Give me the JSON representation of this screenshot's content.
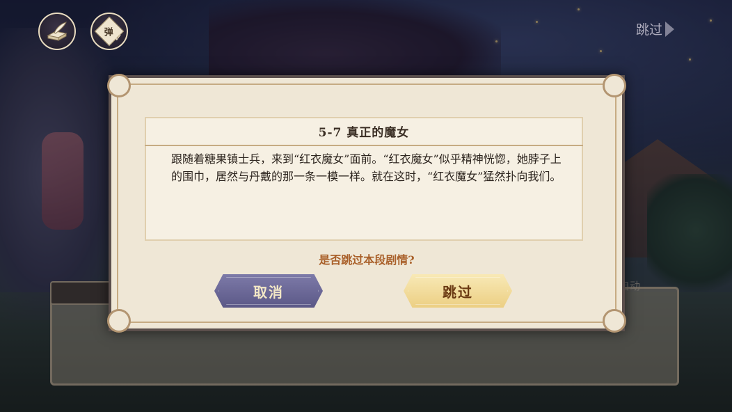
{
  "top_bar": {
    "log_icon": "scroll-quill-icon",
    "danmaku_icon": "danmaku-toggle-icon",
    "danmaku_char": "弹",
    "danmaku_check": "✓",
    "skip_label": "跳过"
  },
  "dialogue": {
    "auto_label": "自动"
  },
  "modal": {
    "title": "5-7  真正的魔女",
    "body": "跟随着糖果镇士兵，来到“红衣魔女”面前。“红衣魔女”似乎精神恍惚，她脖子上的围巾，居然与丹戴的那一条一模一样。就在这时，“红衣魔女”猛然扑向我们。",
    "question": "是否跳过本段剧情?",
    "cancel_label": "取消",
    "confirm_label": "跳过"
  },
  "colors": {
    "cancel_button": "#6b68a0",
    "confirm_button": "#f1d896",
    "question_text": "#a9602a",
    "modal_background": "#efe7d6"
  }
}
